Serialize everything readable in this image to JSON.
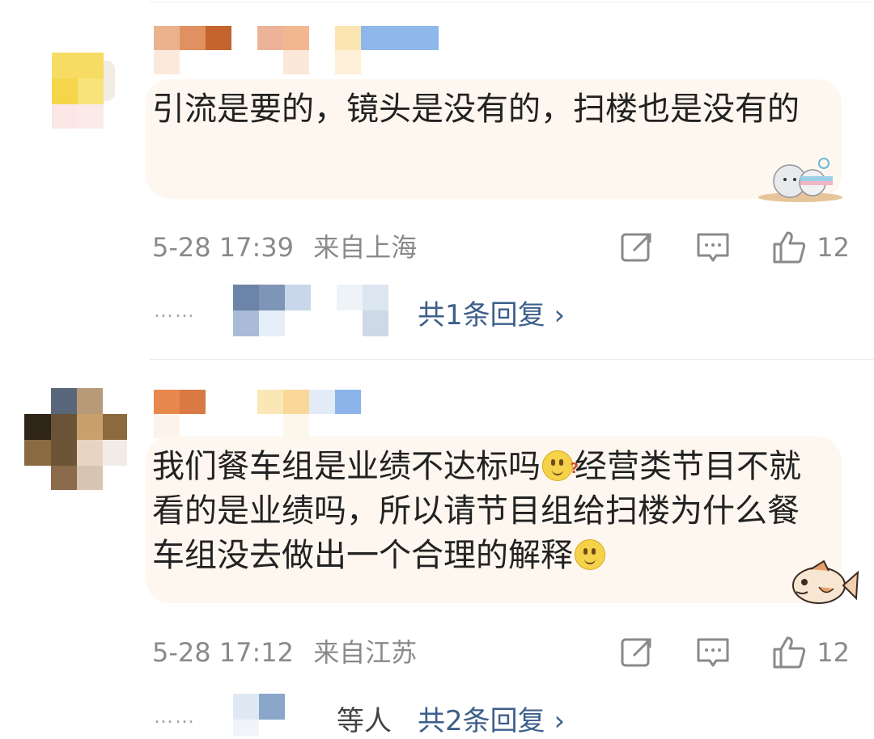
{
  "comments": [
    {
      "text": "引流是要的，镜头是没有的，扫楼也是没有的",
      "time": "5-28 17:39",
      "location": "来自上海",
      "likes": "12",
      "reply_prefix": "",
      "reply_link": "共1条回复 ›"
    },
    {
      "text_part1": "我们餐车组是业绩不达标吗",
      "text_part2": "经营类节目不就看的是业绩吗，所以请节目组给扫楼为什么餐车组没去做出一个合理的解释",
      "time": "5-28 17:12",
      "location": "来自江苏",
      "likes": "12",
      "reply_prefix": "等人",
      "reply_link": "共2条回复 ›"
    }
  ],
  "icons": {
    "share": "share-icon",
    "comment": "comment-icon",
    "like": "thumbs-up-icon"
  },
  "colors": {
    "link": "#3d5f8a",
    "meta": "#8a8a8a",
    "bubble": "#fdf7ef"
  }
}
